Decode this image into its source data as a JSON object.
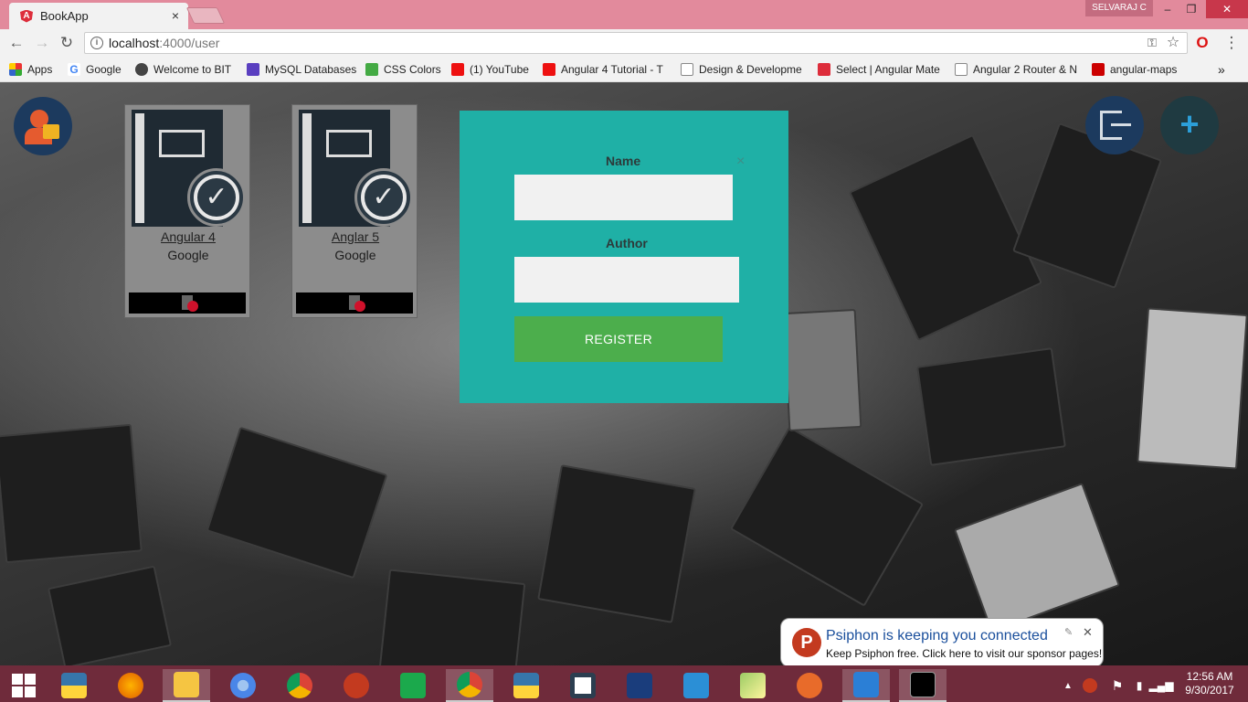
{
  "browser": {
    "tab_title": "BookApp",
    "tab_close": "×",
    "user_name": "SELVARAJ C",
    "url_host": "localhost",
    "url_path": ":4000/user",
    "window_controls": {
      "minimize": "–",
      "maximize": "❐",
      "close": "✕"
    },
    "bookmarks": [
      "Apps",
      "Google",
      "Welcome to BIT",
      "MySQL Databases",
      "CSS Colors",
      "(1) YouTube",
      "Angular 4 Tutorial - T",
      "Design & Developme",
      "Select | Angular Mate",
      "Angular 2 Router & N",
      "angular-maps"
    ],
    "bookmarks_overflow": "»"
  },
  "books": [
    {
      "title": "Angular 4",
      "author": "Google"
    },
    {
      "title": "Anglar 5",
      "author": "Google"
    }
  ],
  "modal": {
    "name_label": "Name",
    "author_label": "Author",
    "name_value": "",
    "author_value": "",
    "close": "×",
    "register_label": "REGISTER"
  },
  "toast": {
    "title": "Psiphon is keeping you connected",
    "body": "Keep Psiphon free. Click here to visit our sponsor pages!",
    "close": "✕",
    "logo_letter": "P"
  },
  "taskbar": {
    "time": "12:56 AM",
    "date": "9/30/2017"
  },
  "colors": {
    "modal_bg": "#1fb0a6",
    "register_bg": "#4cae4c",
    "tabstrip": "#e28a9c",
    "taskbar": "#6f2b3b"
  }
}
